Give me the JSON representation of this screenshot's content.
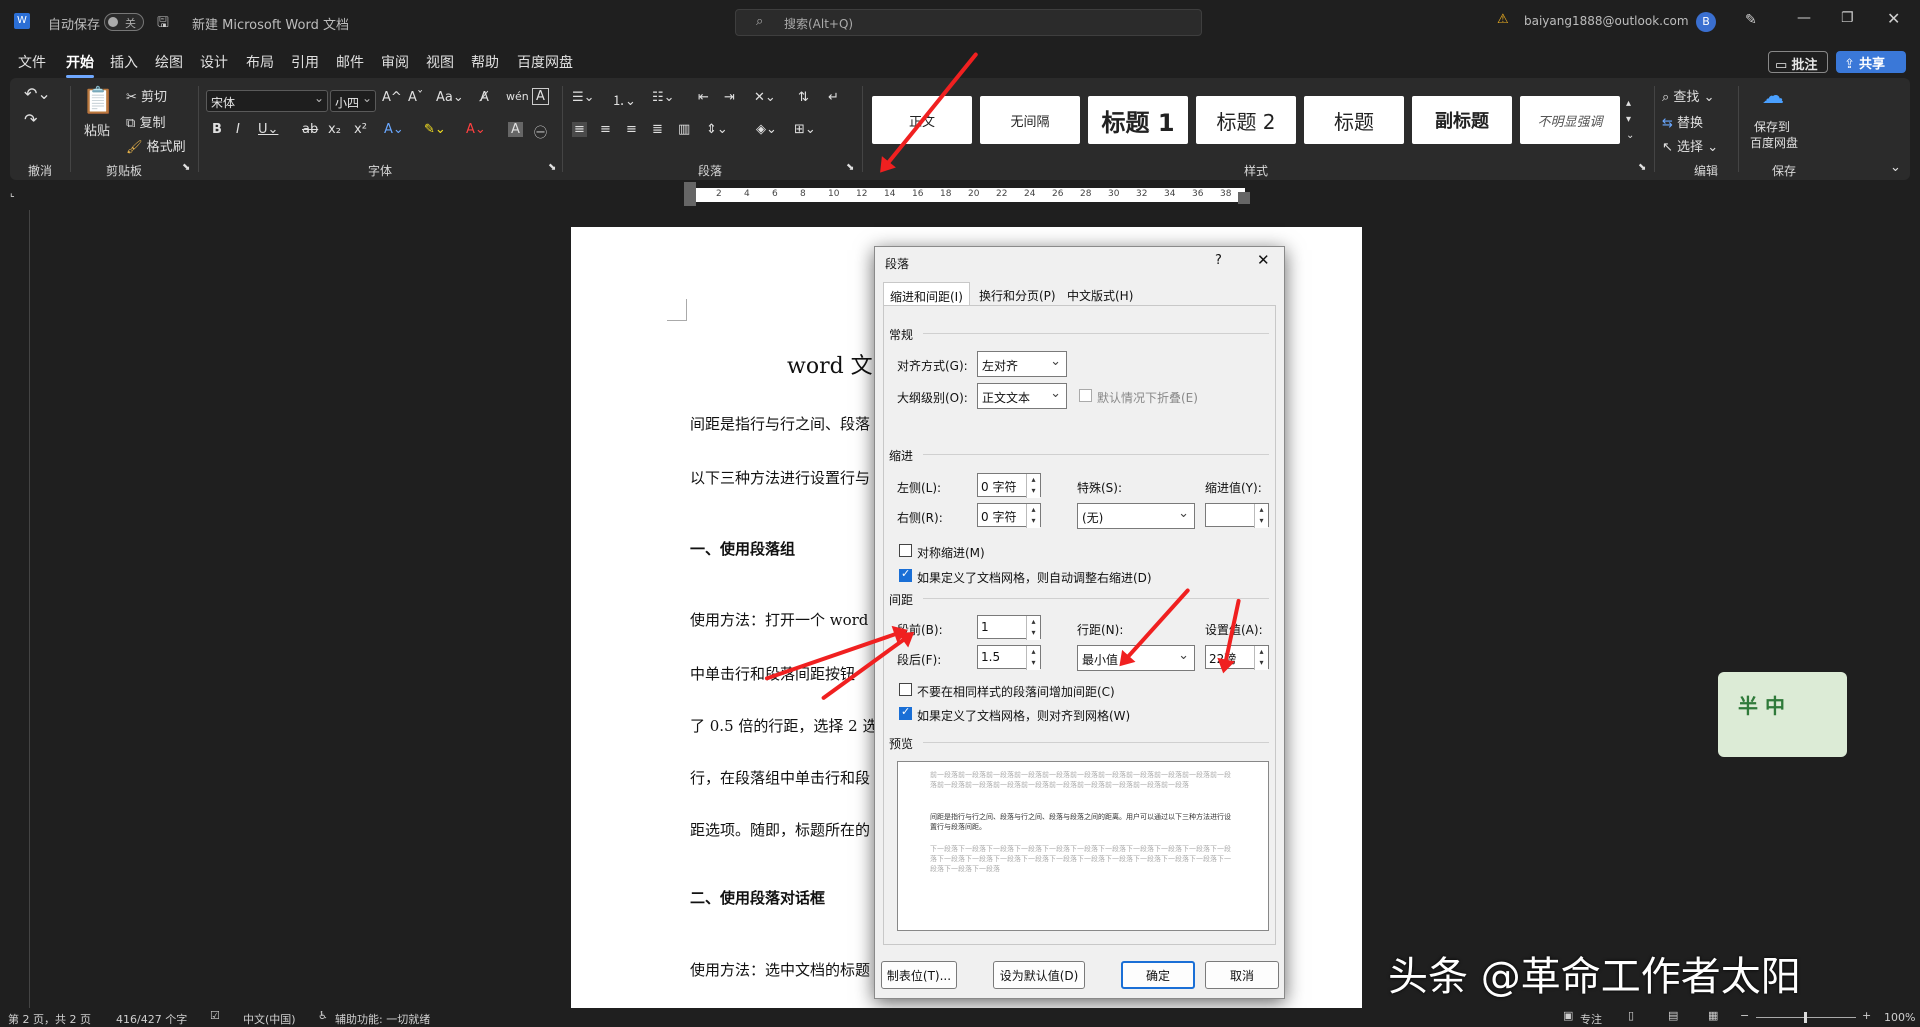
{
  "titlebar": {
    "autosave_label": "自动保存",
    "autosave_state": "关",
    "doc_title": "新建 Microsoft Word 文档",
    "search_placeholder": "搜索(Alt+Q)",
    "account_email": "baiyang1888@outlook.com",
    "avatar_letter": "B"
  },
  "menu": {
    "items": [
      "文件",
      "开始",
      "插入",
      "绘图",
      "设计",
      "布局",
      "引用",
      "邮件",
      "审阅",
      "视图",
      "帮助",
      "百度网盘"
    ],
    "comment_label": "批注",
    "share_label": "共享"
  },
  "ribbon": {
    "clipboard": {
      "paste": "粘贴",
      "cut": "剪切",
      "copy": "复制",
      "format_painter": "格式刷",
      "group": "剪贴板",
      "undo_group": "撤消"
    },
    "font": {
      "font_name": "宋体",
      "font_size": "小四",
      "group": "字体"
    },
    "paragraph": {
      "group": "段落"
    },
    "styles": {
      "items": [
        "正文",
        "无间隔",
        "标题 1",
        "标题 2",
        "标题",
        "副标题",
        "不明显强调"
      ],
      "group": "样式"
    },
    "editing": {
      "find": "查找",
      "replace": "替换",
      "select": "选择",
      "group": "编辑"
    },
    "save": {
      "label1": "保存到",
      "label2": "百度网盘",
      "group": "保存"
    }
  },
  "ruler": {
    "ticks": [
      "2",
      "4",
      "6",
      "8",
      "10",
      "12",
      "14",
      "16",
      "18",
      "20",
      "22",
      "24",
      "26",
      "28",
      "30",
      "32",
      "34",
      "36",
      "38"
    ]
  },
  "document": {
    "title": "word 文",
    "lines": [
      "间距是指行与行之间、段落",
      "以下三种方法进行设置行与",
      "一、使用段落组",
      "使用方法：打开一个 word",
      "中单击行和段落间距按钮",
      "了 0.5 倍的行距，选择 2 选",
      "行，在段落组中单击行和段",
      "距选项。随即，标题所在的",
      "二、使用段落对话框",
      "使用方法：选中文档的标题"
    ]
  },
  "dialog": {
    "title": "段落",
    "help": "?",
    "tabs": [
      "缩进和间距(I)",
      "换行和分页(P)",
      "中文版式(H)"
    ],
    "general": {
      "section": "常规",
      "align_label": "对齐方式(G):",
      "align_value": "左对齐",
      "outline_label": "大纲级别(O):",
      "outline_value": "正文文本",
      "collapse_label": "默认情况下折叠(E)"
    },
    "indent": {
      "section": "缩进",
      "left_label": "左侧(L):",
      "left_value": "0 字符",
      "right_label": "右侧(R):",
      "right_value": "0 字符",
      "special_label": "特殊(S):",
      "special_value": "(无)",
      "by_label": "缩进值(Y):",
      "by_value": "",
      "mirror_label": "对称缩进(M)",
      "auto_label": "如果定义了文档网格，则自动调整右缩进(D)"
    },
    "spacing": {
      "section": "间距",
      "before_label": "段前(B):",
      "before_value": "1",
      "after_label": "段后(F):",
      "after_value": "1.5",
      "line_label": "行距(N):",
      "line_value": "最小值",
      "at_label": "设置值(A):",
      "at_value": "22磅",
      "nospace_label": "不要在相同样式的段落间增加间距(C)",
      "snap_label": "如果定义了文档网格，则对齐到网格(W)"
    },
    "preview": {
      "section": "预览",
      "prev_text": "前一段落前一段落前一段落前一段落前一段落前一段落前一段落前一段落前一段落前一段落前一段落前一段落前一段落前一段落前一段落前一段落前一段落前一段落前一段落前一段落",
      "sample_text": "间距是指行与行之间、段落与行之间、段落与段落之间的距离。用户可以通过以下三种方法进行设置行与段落间距。",
      "next_text": "下一段落下一段落下一段落下一段落下一段落下一段落下一段落下一段落下一段落下一段落下一段落下一段落下一段落下一段落下一段落下一段落下一段落下一段落下一段落下一段落下一段落下一段落下一段落下一段落"
    },
    "buttons": {
      "tabs": "制表位(T)...",
      "default": "设为默认值(D)",
      "ok": "确定",
      "cancel": "取消"
    }
  },
  "watermark": {
    "text": "头条 @革命工作者太阳",
    "sticker": "半 中"
  },
  "status": {
    "page": "第 2 页，共 2 页",
    "words": "416/427 个字",
    "lang": "中文(中国)",
    "access": "辅助功能: 一切就绪",
    "focus": "专注",
    "zoom": "100%"
  }
}
